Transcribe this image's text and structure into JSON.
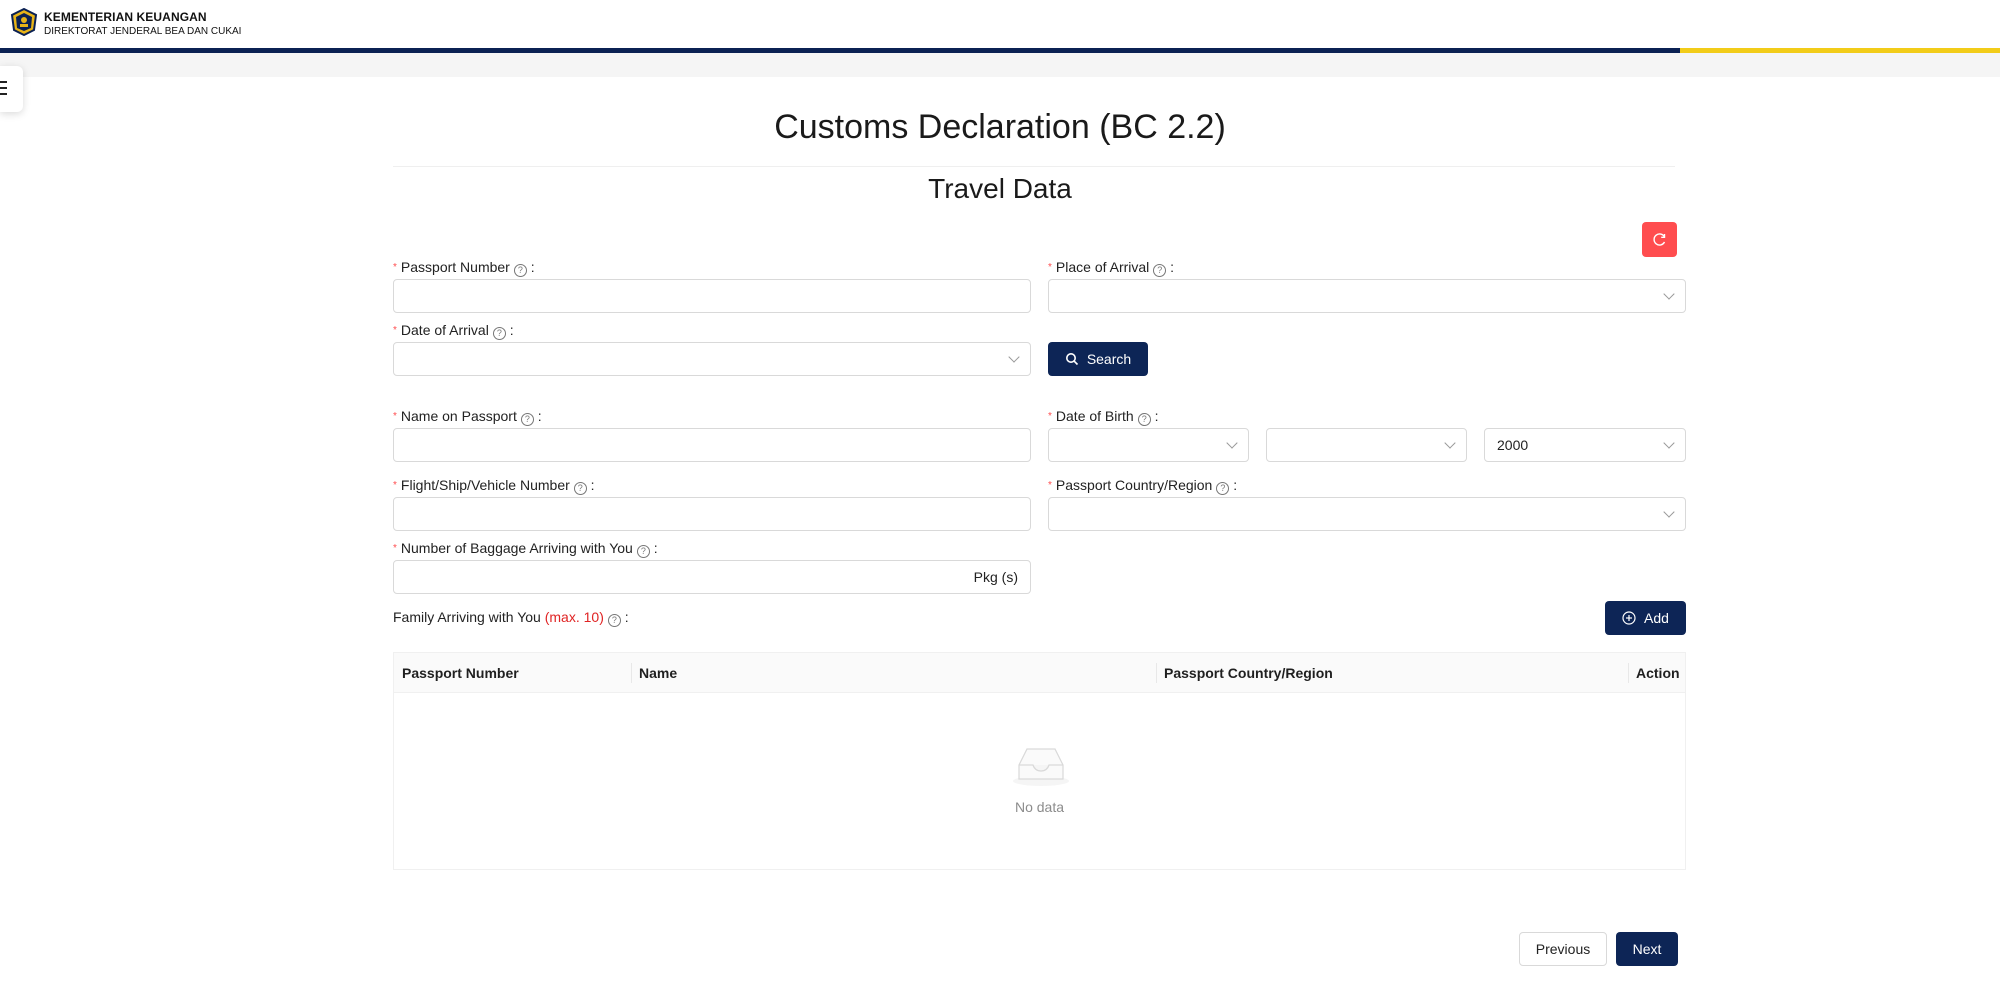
{
  "header": {
    "org_line1": "KEMENTERIAN KEUANGAN",
    "org_line2": "DIREKTORAT JENDERAL BEA DAN CUKAI"
  },
  "page": {
    "title": "Customs Declaration (BC 2.2)",
    "section_title": "Travel Data"
  },
  "form": {
    "passport_number": {
      "label": "Passport Number",
      "suffix": ":",
      "value": ""
    },
    "place_of_arrival": {
      "label": "Place of Arrival",
      "suffix": ":",
      "value": ""
    },
    "date_of_arrival": {
      "label": "Date of Arrival",
      "suffix": ":",
      "value": ""
    },
    "search_label": "Search",
    "name_on_passport": {
      "label": "Name on Passport",
      "suffix": ":",
      "value": ""
    },
    "date_of_birth": {
      "label": "Date of Birth",
      "suffix": ":",
      "day": "",
      "month": "",
      "year": "2000"
    },
    "flight_number": {
      "label": "Flight/Ship/Vehicle Number",
      "suffix": ":",
      "value": ""
    },
    "passport_country": {
      "label": "Passport Country/Region",
      "suffix": ":",
      "value": ""
    },
    "baggage": {
      "label": "Number of Baggage Arriving with You",
      "suffix": ":",
      "value": "",
      "unit": "Pkg (s)"
    },
    "family": {
      "label": "Family Arriving with You",
      "max_note": "(max. 10)",
      "suffix": ":",
      "add_label": "Add"
    }
  },
  "family_table": {
    "columns": [
      "Passport Number",
      "Name",
      "Passport Country/Region",
      "Action"
    ],
    "rows": [],
    "empty_text": "No data"
  },
  "footer": {
    "previous_label": "Previous",
    "next_label": "Next"
  },
  "colors": {
    "primary": "#0d2556",
    "danger": "#ff4d4f",
    "accent_yellow": "#f2cc19",
    "required": "#ff4d4f"
  },
  "icons": {
    "logo": "kemenkeu-emblem",
    "menu": "hamburger-icon",
    "reset": "reload-icon",
    "help": "question-circle-icon",
    "search": "search-icon",
    "add": "plus-circle-icon",
    "empty": "empty-inbox-icon"
  }
}
